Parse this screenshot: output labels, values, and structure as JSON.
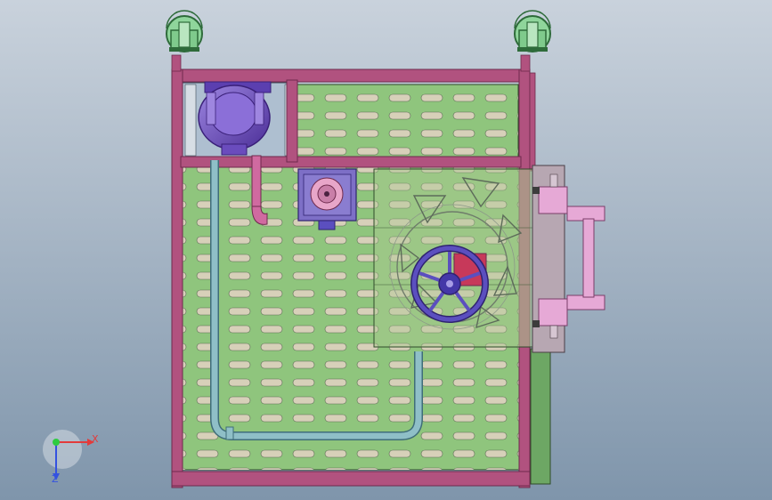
{
  "viewport": {
    "background_top": "#c9d2dc",
    "background_bottom": "#7f95ab"
  },
  "colors": {
    "frame": "#b1527f",
    "frame_dark": "#6e2a4d",
    "panel": "#8fc57d",
    "panel_dark": "#4f7a44",
    "slot": "#d7d0b9",
    "pipe": "#8fbfc7",
    "pipe_dark": "#3f6d78",
    "caster": "#8fd59b",
    "caster_dark": "#2e6b3a",
    "motor": "#7b57c7",
    "motor_dark": "#3a2079",
    "gearbox": "#7d6fc6",
    "wheel": "#5b4fbf",
    "handle": "#e6a9d6",
    "handle_dark": "#7a3d68",
    "axis_x": "#e23b3b",
    "axis_y": "#2ecc40",
    "axis_z": "#3452e0"
  },
  "icons": [
    "caster-wheel-icon",
    "motor-icon",
    "gearbox-icon",
    "handwheel-icon",
    "triad-axis-icon"
  ],
  "triad": {
    "x_label": "X",
    "z_label": "Z"
  }
}
